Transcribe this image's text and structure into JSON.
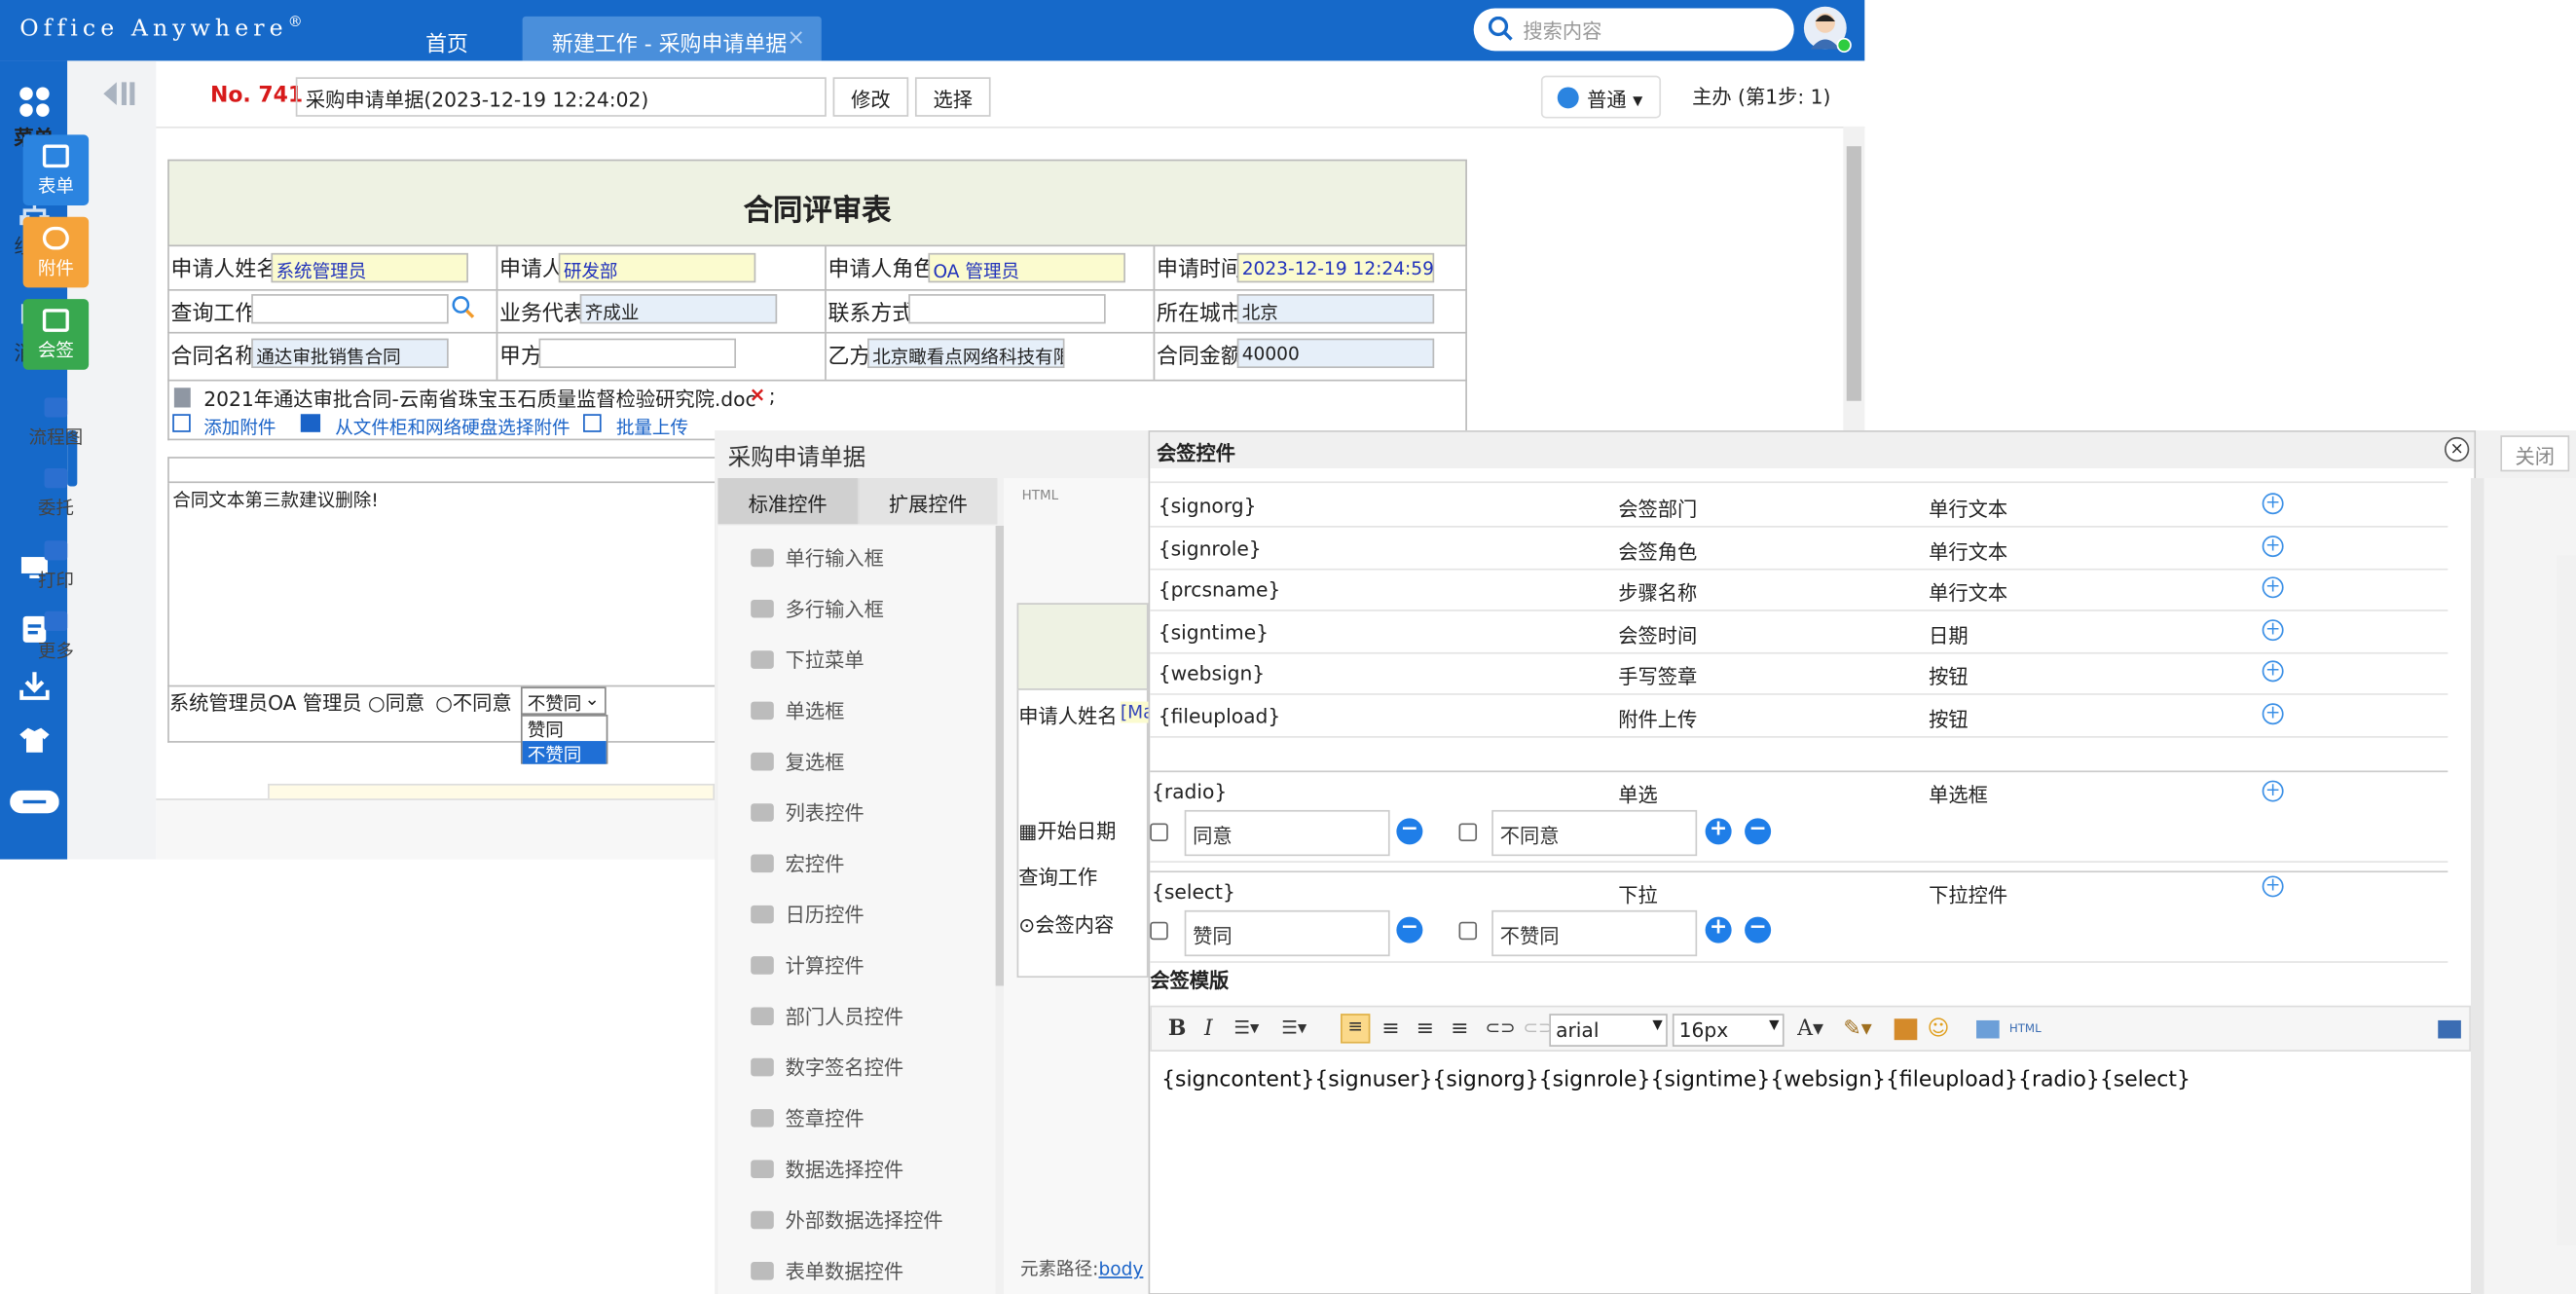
{
  "app": {
    "logo": "Office Anywhere",
    "logo_mark": "®",
    "home_tab": "首页",
    "active_tab": "新建工作 - 采购申请单据",
    "search_placeholder": "搜索内容"
  },
  "leftnav": {
    "items": [
      {
        "label": "菜单"
      },
      {
        "label": "组织"
      },
      {
        "label": "消息"
      }
    ]
  },
  "toolcol": {
    "tiles": [
      {
        "label": "表单",
        "color": "#2b84e0"
      },
      {
        "label": "附件",
        "color": "#f5a33a"
      },
      {
        "label": "会签",
        "color": "#38a84f"
      }
    ],
    "small": [
      "流程图",
      "委托",
      "打印",
      "更多"
    ]
  },
  "header": {
    "no": "No. 741",
    "title_value": "采购申请单据(2023-12-19 12:24:02)",
    "modify": "修改",
    "select": "选择",
    "priority": "普通",
    "step": "主办 (第1步:  1)"
  },
  "form": {
    "title": "合同评审表",
    "applicant_name_label": "申请人姓名",
    "applicant_name": "系统管理员",
    "applicant_label": "申请人",
    "applicant": "研发部",
    "role_label": "申请人角色",
    "role": "OA 管理员",
    "time_label": "申请时间",
    "time": "2023-12-19 12:24:59",
    "query_label": "查询工作",
    "rep_label": "业务代表",
    "rep": "齐成业",
    "contact_label": "联系方式",
    "city_label": "所在城市",
    "city": "北京",
    "contract_label": "合同名称",
    "contract": "通达审批销售合同",
    "partya_label": "甲方",
    "partyb_label": "乙方",
    "partyb": "北京瞰看点网络科技有限",
    "amount_label": "合同金额",
    "amount": "40000",
    "attachment": "2021年通达审批合同-云南省珠宝玉石质量监督检验研究院.doc",
    "attachment_suffix": ";",
    "add_attachment": "添加附件",
    "from_cabinet": "从文件柜和网络硬盘选择附件",
    "batch_upload": "批量上传",
    "note": "合同文本第三款建议删除!",
    "sign_line": "系统管理员OA 管理员",
    "agree": "同意",
    "disagree": "不同意",
    "select_value": "不赞同",
    "options": [
      "赞同",
      "不赞同"
    ]
  },
  "editor": {
    "title": "采购申请单据",
    "tabs": [
      "标准控件",
      "扩展控件"
    ],
    "close": "关闭",
    "controls": [
      "单行输入框",
      "多行输入框",
      "下拉菜单",
      "单选框",
      "复选框",
      "列表控件",
      "宏控件",
      "日历控件",
      "计算控件",
      "部门人员控件",
      "数字签名控件",
      "签章控件",
      "数据选择控件",
      "外部数据选择控件",
      "表单数据控件"
    ],
    "mid_labels": [
      "申请人姓名",
      "开始日期",
      "查询工作",
      "会签内容"
    ],
    "mid_input": "Ma",
    "path_label": "元素路径:",
    "path": "body"
  },
  "dialog": {
    "title": "会签控件",
    "rows": [
      {
        "code": "{signorg}",
        "name": "会签部门",
        "type": "单行文本"
      },
      {
        "code": "{signrole}",
        "name": "会签角色",
        "type": "单行文本"
      },
      {
        "code": "{prcsname}",
        "name": "步骤名称",
        "type": "单行文本"
      },
      {
        "code": "{signtime}",
        "name": "会签时间",
        "type": "日期"
      },
      {
        "code": "{websign}",
        "name": "手写签章",
        "type": "按钮"
      },
      {
        "code": "{fileupload}",
        "name": "附件上传",
        "type": "按钮"
      }
    ],
    "radio": {
      "code": "{radio}",
      "name": "单选",
      "type": "单选框",
      "opt1": "同意",
      "opt2": "不同意"
    },
    "select": {
      "code": "{select}",
      "name": "下拉",
      "type": "下拉控件",
      "opt1": "赞同",
      "opt2": "不赞同"
    },
    "template_label": "会签模版",
    "font": "arial",
    "size": "16px",
    "template": "{signcontent}{signuser}{signorg}{signrole}{signtime}{websign}{fileupload}{radio}{select}"
  }
}
